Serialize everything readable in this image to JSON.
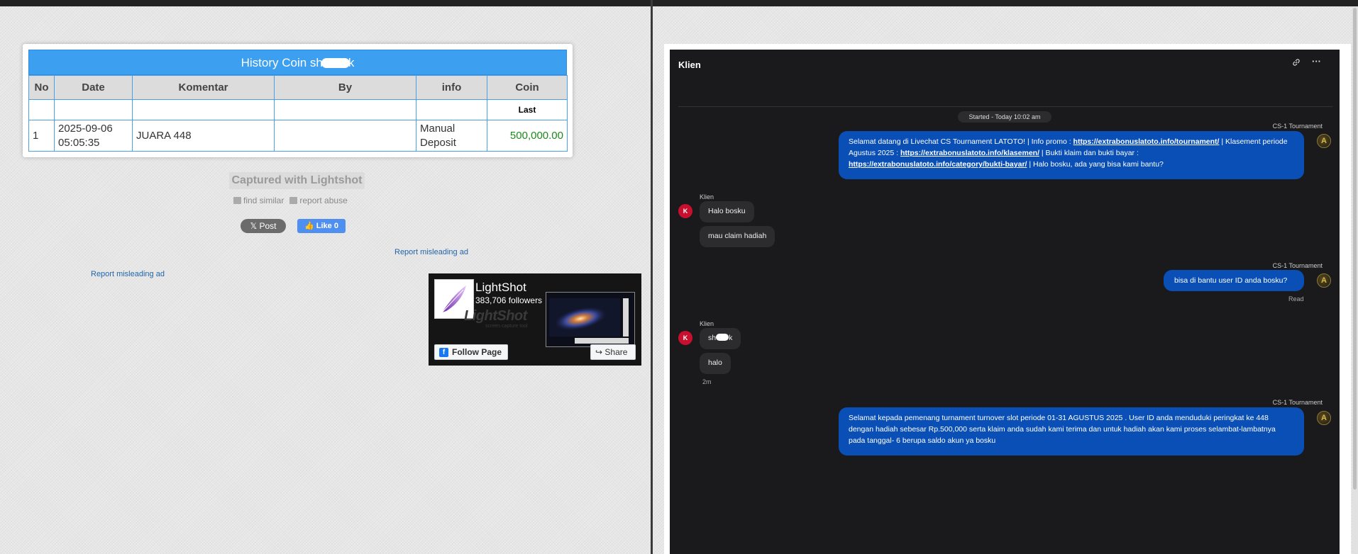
{
  "history": {
    "title_prefix": "History Coin sh",
    "title_suffix": "k",
    "columns": [
      "No",
      "Date",
      "Komentar",
      "By",
      "info",
      "Coin"
    ],
    "subheader": "Last",
    "rows": [
      {
        "no": "1",
        "date_line1": "2025-09-06",
        "date_line2": "05:05:35",
        "komentar": "JUARA 448",
        "by": "",
        "info_line1": "Manual",
        "info_line2": "Deposit",
        "coin": "500,000.00"
      }
    ]
  },
  "lightshot": {
    "captured": "Captured with Lightshot",
    "find_similar": "find similar",
    "report_abuse": "report abuse",
    "x_post": "Post",
    "fb_like": "Like 0",
    "report_ad_1": "Report misleading ad",
    "report_ad_2": "Report misleading ad"
  },
  "fb_widget": {
    "name": "LightShot",
    "followers": "383,706 followers",
    "watermark": "LightShot",
    "watermark_sub": "screen capture tool",
    "follow": "Follow Page",
    "share": "Share"
  },
  "chat": {
    "title": "Klien",
    "started": "Started - Today 10:02 am",
    "agent_name": "CS-1 Tournament",
    "client_name": "Klien",
    "client_initial": "K",
    "msg1": {
      "t1": "Selamat datang di Livechat CS Tournament LATOTO! | Info promo : ",
      "l1": "https://extrabonuslatoto.info/tournament/",
      "t2": " | Klasement periode Agustus 2025 : ",
      "l2": "https://extrabonuslatoto.info/klasemen/",
      "t3": " | Bukti klaim dan bukti bayar : ",
      "l3": "https://extrabonuslatoto.info/category/bukti-bayar/",
      "t4": " | Halo bosku, ada yang bisa kami bantu?"
    },
    "client_msg1": "Halo bosku",
    "client_msg2": "mau claim hadiah",
    "agent_msg2": "bisa di bantu user ID anda bosku?",
    "read_label": "Read",
    "client_msg3_prefix": "sh",
    "client_msg3_suffix": "k",
    "client_msg4": "halo",
    "client_time": "2m",
    "agent_msg3": "Selamat kepada pemenang turnament turnover slot periode 01-31 AGUSTUS 2025 . User ID anda menduduki peringkat ke 448 dengan hadiah sebesar Rp.500,000 serta klaim anda sudah kami terima dan untuk hadiah akan kami proses selambat-lambatnya pada tanggal- 6 berupa saldo akun ya bosku"
  }
}
